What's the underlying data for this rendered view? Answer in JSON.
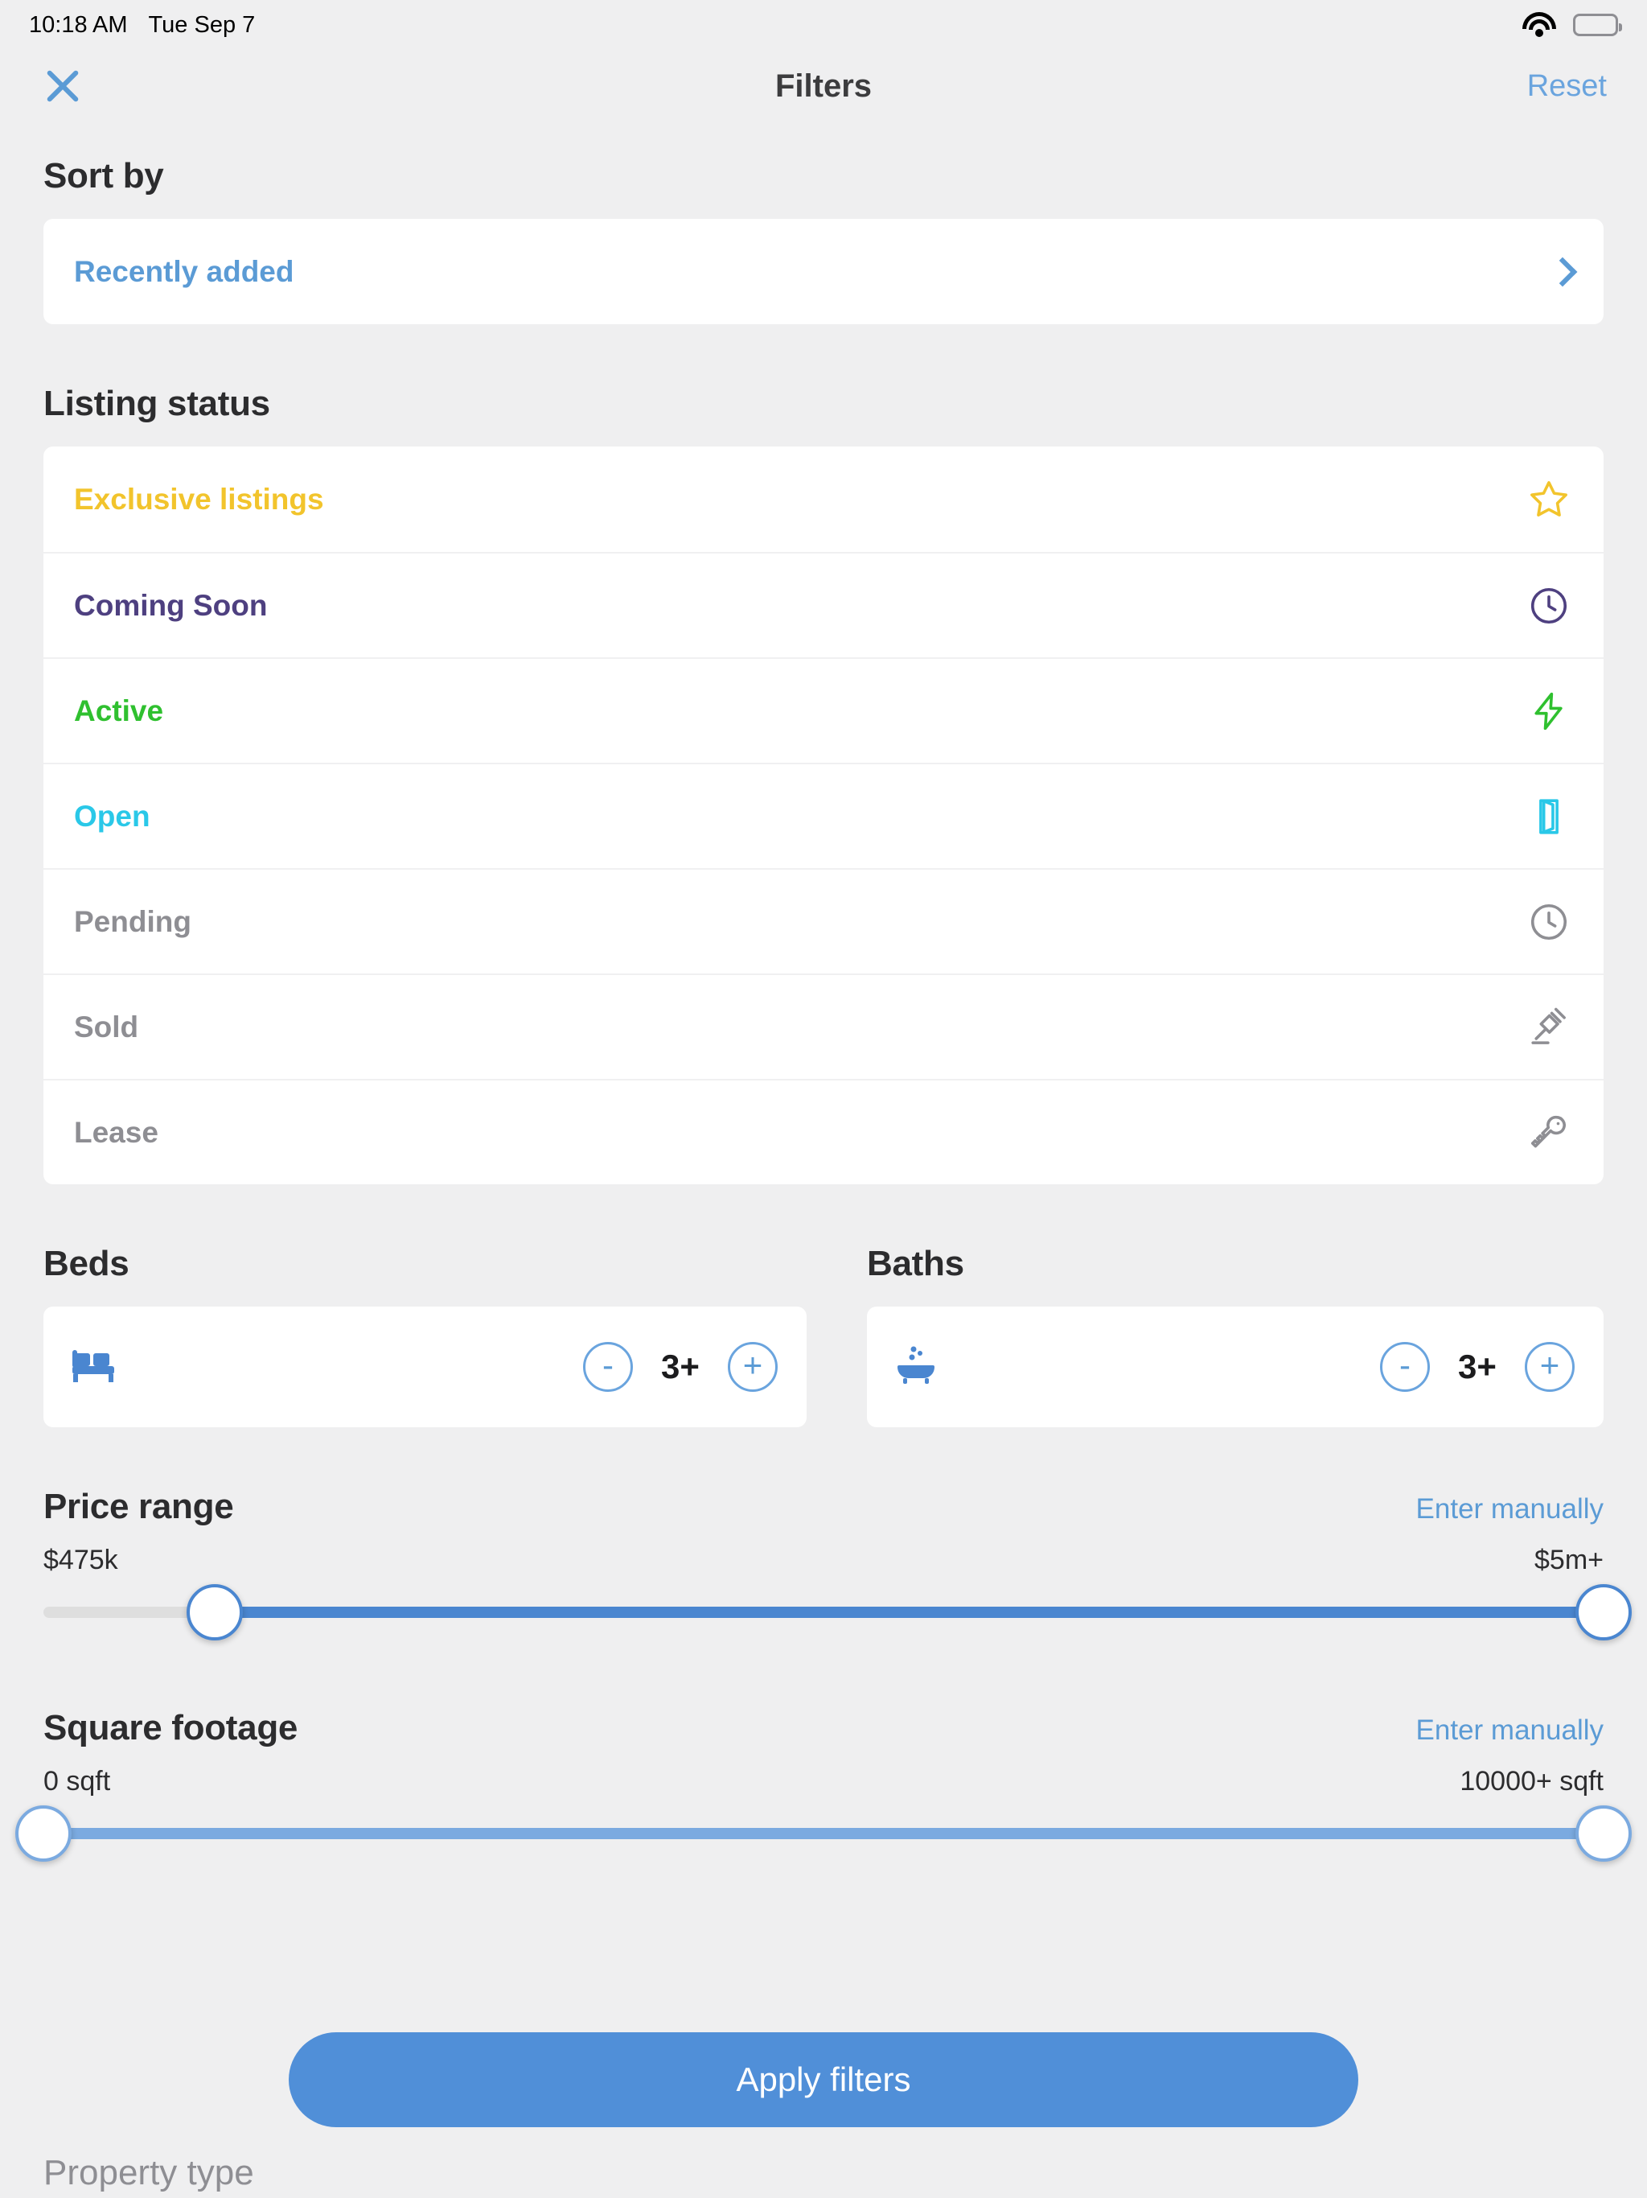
{
  "status_bar": {
    "time": "10:18 AM",
    "date": "Tue Sep 7",
    "wifi_icon": "wifi-icon",
    "battery_icon": "battery-icon",
    "battery_level_pct": 78
  },
  "nav": {
    "close_icon": "close-icon",
    "title": "Filters",
    "reset_label": "Reset"
  },
  "sort_by": {
    "heading": "Sort by",
    "selected": "Recently added",
    "chevron_icon": "chevron-right-icon"
  },
  "listing_status": {
    "heading": "Listing status",
    "items": [
      {
        "label": "Exclusive listings",
        "color": "#f2c42c",
        "icon": "star-icon"
      },
      {
        "label": "Coming Soon",
        "color": "#4e4080",
        "icon": "clock-icon"
      },
      {
        "label": "Active",
        "color": "#2fc02f",
        "icon": "lightning-bolt-icon"
      },
      {
        "label": "Open",
        "color": "#2ac8e8",
        "icon": "open-door-icon"
      },
      {
        "label": "Pending",
        "color": "#8e8e93",
        "icon": "clock-icon"
      },
      {
        "label": "Sold",
        "color": "#8e8e93",
        "icon": "gavel-icon"
      },
      {
        "label": "Lease",
        "color": "#8e8e93",
        "icon": "key-icon"
      }
    ]
  },
  "beds": {
    "heading": "Beds",
    "icon": "bed-icon",
    "decrement_label": "-",
    "value": "3+",
    "increment_label": "+"
  },
  "baths": {
    "heading": "Baths",
    "icon": "bathtub-icon",
    "decrement_label": "-",
    "value": "3+",
    "increment_label": "+"
  },
  "price_range": {
    "heading": "Price range",
    "manual_label": "Enter manually",
    "min_label": "$475k",
    "max_label": "$5m+",
    "min_pct": 11,
    "max_pct": 100
  },
  "square_footage": {
    "heading": "Square footage",
    "manual_label": "Enter manually",
    "min_label": "0 sqft",
    "max_label": "10000+ sqft",
    "min_pct": 0,
    "max_pct": 100
  },
  "apply": {
    "label": "Apply filters"
  },
  "property_type": {
    "heading": "Property type"
  },
  "accent_color": "#508fd8"
}
